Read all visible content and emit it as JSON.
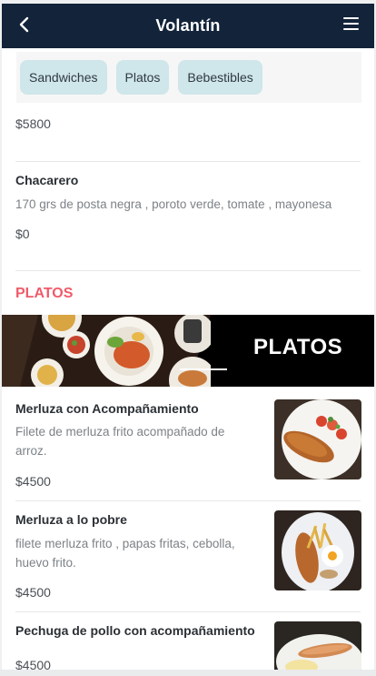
{
  "header": {
    "title": "Volantín",
    "back_icon": "chevron-left-icon",
    "menu_icon": "hamburger-menu-icon"
  },
  "categories": [
    {
      "label": "Sandwiches"
    },
    {
      "label": "Platos"
    },
    {
      "label": "Bebestibles"
    }
  ],
  "sandwiches_tail": {
    "price": "$5800"
  },
  "chacarero": {
    "name": "Chacarero",
    "description": "170 grs de posta negra , poroto verde, tomate , mayonesa",
    "price": "$0"
  },
  "platos_section": {
    "title": "PLATOS",
    "banner_text": "PLATOS"
  },
  "platos": [
    {
      "name": "Merluza con Acompañamiento",
      "description_line1": "Filete de merluza frito acompañado de",
      "description_line2": "arroz.",
      "price": "$4500"
    },
    {
      "name": "Merluza a lo pobre",
      "description_line1": "filete merluza frito , papas fritas, cebolla,",
      "description_line2": "huevo frito.",
      "price": "$4500"
    },
    {
      "name": "Pechuga de pollo con acompañamiento",
      "price": "$4500"
    }
  ],
  "colors": {
    "header_bg": "#12233a",
    "chip_bg": "#cfe6ea",
    "section_accent": "#ef5b6a"
  }
}
